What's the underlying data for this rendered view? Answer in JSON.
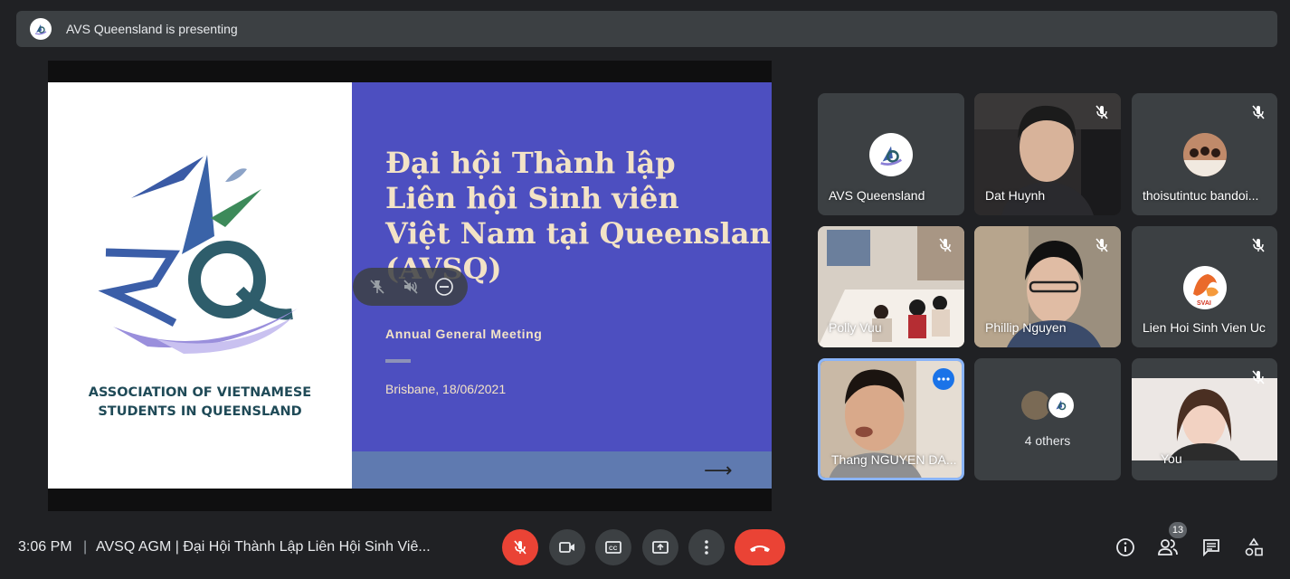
{
  "banner": {
    "text": "AVS Queensland is presenting"
  },
  "slide": {
    "title_lines": [
      "Đại hội Thành lập",
      "Liên hội Sinh viên",
      "Việt Nam tại Queensland",
      "(AVSQ)"
    ],
    "subtitle": "Annual General Meeting",
    "date": "Brisbane, 18/06/2021",
    "association_lines": [
      "ASSOCIATION OF VIETNAMESE",
      "STUDENTS IN QUEENSLAND"
    ],
    "arrow": "⟶",
    "logo_text": "AVSQ",
    "colors": {
      "right_panel": "#4d4fc0",
      "footer_band": "#5f7ab0",
      "title": "#f3e3c6",
      "assoc": "#1f4a57"
    }
  },
  "participants": [
    {
      "name": "AVS Queensland",
      "muted": false,
      "kind": "logo"
    },
    {
      "name": "Dat Huynh",
      "muted": true,
      "kind": "camera"
    },
    {
      "name": "thoisutintuc bandoi...",
      "muted": true,
      "kind": "photo"
    },
    {
      "name": "Polly Vuu",
      "muted": true,
      "kind": "camera"
    },
    {
      "name": "Phillip Nguyen",
      "muted": true,
      "kind": "camera"
    },
    {
      "name": "Lien Hoi Sinh Vien Uc",
      "muted": true,
      "kind": "logo"
    },
    {
      "name": "Thang NGUYEN DA...",
      "muted": false,
      "kind": "camera",
      "active": true
    },
    {
      "name": "4 others",
      "kind": "group"
    },
    {
      "name": "You",
      "muted": true,
      "kind": "camera"
    }
  ],
  "lien_hoi_logo_text": "SVAI",
  "bottom": {
    "time": "3:06 PM",
    "separator": "|",
    "meeting_title": "AVSQ AGM | Đại Hội Thành Lập Liên Hội Sinh Viê...",
    "participant_count": "13"
  },
  "icons": [
    "mic-off-icon",
    "camera-icon",
    "captions-icon",
    "present-icon",
    "more-vert-icon",
    "hangup-icon",
    "info-icon",
    "people-icon",
    "chat-icon",
    "activities-icon"
  ],
  "colors": {
    "bg": "#202124",
    "surface": "#3c4043",
    "red": "#ea4335",
    "active_border": "#8ab4f8"
  }
}
